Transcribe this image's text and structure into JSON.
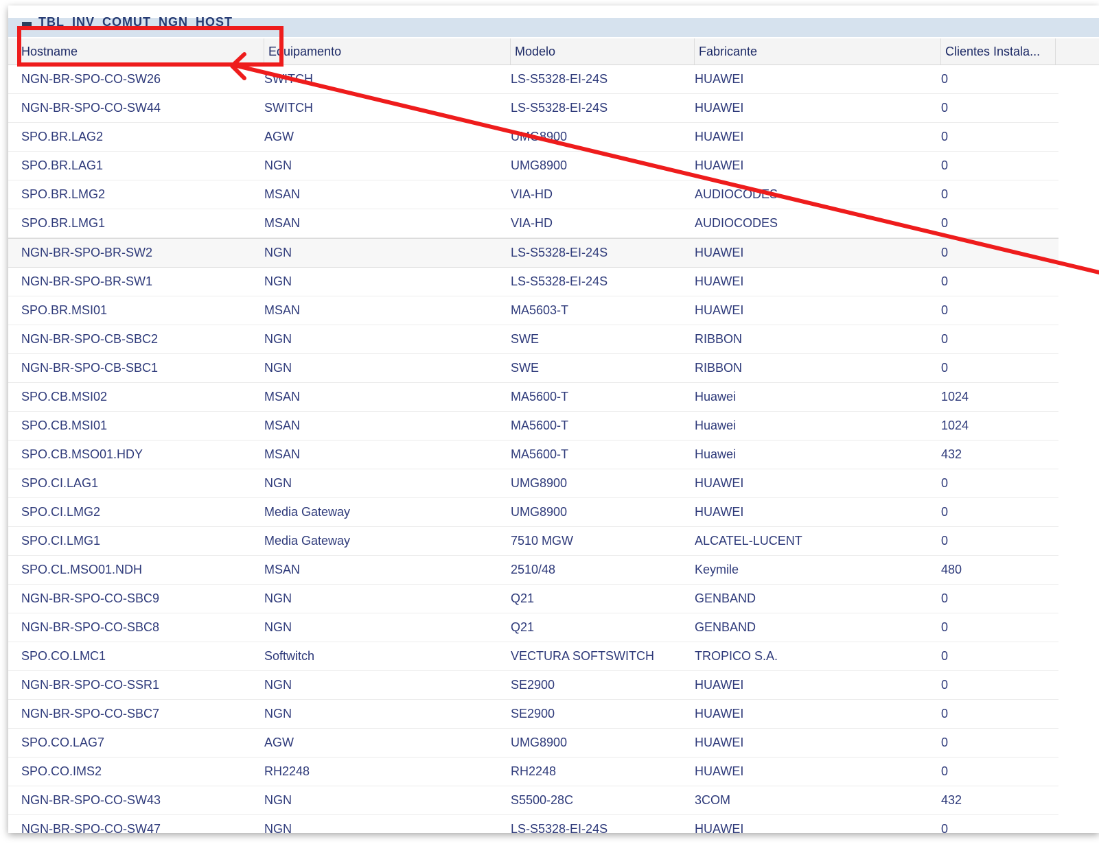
{
  "window": {
    "title": "TBL_INV_COMUT_NGN_HOST"
  },
  "columns": [
    "Hostname",
    "Equipamento",
    "Modelo",
    "Fabricante",
    "Clientes Instala..."
  ],
  "rows": [
    [
      "NGN-BR-SPO-CO-SW26",
      "SWITCH",
      "LS-S5328-EI-24S",
      "HUAWEI",
      "0"
    ],
    [
      "NGN-BR-SPO-CO-SW44",
      "SWITCH",
      "LS-S5328-EI-24S",
      "HUAWEI",
      "0"
    ],
    [
      "SPO.BR.LAG2",
      "AGW",
      "UMG8900",
      "HUAWEI",
      "0"
    ],
    [
      "SPO.BR.LAG1",
      "NGN",
      "UMG8900",
      "HUAWEI",
      "0"
    ],
    [
      "SPO.BR.LMG2",
      "MSAN",
      "VIA-HD",
      "AUDIOCODES",
      "0"
    ],
    [
      "SPO.BR.LMG1",
      "MSAN",
      "VIA-HD",
      "AUDIOCODES",
      "0"
    ],
    [
      "NGN-BR-SPO-BR-SW2",
      "NGN",
      "LS-S5328-EI-24S",
      "HUAWEI",
      "0"
    ],
    [
      "NGN-BR-SPO-BR-SW1",
      "NGN",
      "LS-S5328-EI-24S",
      "HUAWEI",
      "0"
    ],
    [
      "SPO.BR.MSI01",
      "MSAN",
      "MA5603-T",
      "HUAWEI",
      "0"
    ],
    [
      "NGN-BR-SPO-CB-SBC2",
      "NGN",
      "SWE",
      "RIBBON",
      "0"
    ],
    [
      "NGN-BR-SPO-CB-SBC1",
      "NGN",
      "SWE",
      "RIBBON",
      "0"
    ],
    [
      "SPO.CB.MSI02",
      "MSAN",
      "MA5600-T",
      "Huawei",
      "1024"
    ],
    [
      "SPO.CB.MSI01",
      "MSAN",
      "MA5600-T",
      "Huawei",
      "1024"
    ],
    [
      "SPO.CB.MSO01.HDY",
      "MSAN",
      "MA5600-T",
      "Huawei",
      "432"
    ],
    [
      "SPO.CI.LAG1",
      "NGN",
      "UMG8900",
      "HUAWEI",
      "0"
    ],
    [
      "SPO.CI.LMG2",
      "Media Gateway",
      "UMG8900",
      "HUAWEI",
      "0"
    ],
    [
      "SPO.CI.LMG1",
      "Media Gateway",
      "7510 MGW",
      "ALCATEL-LUCENT",
      "0"
    ],
    [
      "SPO.CL.MSO01.NDH",
      "MSAN",
      "2510/48",
      "Keymile",
      "480"
    ],
    [
      "NGN-BR-SPO-CO-SBC9",
      "NGN",
      "Q21",
      "GENBAND",
      "0"
    ],
    [
      "NGN-BR-SPO-CO-SBC8",
      "NGN",
      "Q21",
      "GENBAND",
      "0"
    ],
    [
      "SPO.CO.LMC1",
      "Softwitch",
      "VECTURA SOFTSWITCH",
      "TROPICO S.A.",
      "0"
    ],
    [
      "NGN-BR-SPO-CO-SSR1",
      "NGN",
      "SE2900",
      "HUAWEI",
      "0"
    ],
    [
      "NGN-BR-SPO-CO-SBC7",
      "NGN",
      "SE2900",
      "HUAWEI",
      "0"
    ],
    [
      "SPO.CO.LAG7",
      "AGW",
      "UMG8900",
      "HUAWEI",
      "0"
    ],
    [
      "SPO.CO.IMS2",
      "RH2248",
      "RH2248",
      "HUAWEI",
      "0"
    ],
    [
      "NGN-BR-SPO-CO-SW43",
      "NGN",
      "S5500-28C",
      "3COM",
      "432"
    ],
    [
      "NGN-BR-SPO-CO-SW47",
      "NGN",
      "LS-S5328-EI-24S",
      "HUAWEI",
      "0"
    ]
  ],
  "selected_row_index": 6,
  "annotation": {
    "color": "#ee1c1c"
  }
}
